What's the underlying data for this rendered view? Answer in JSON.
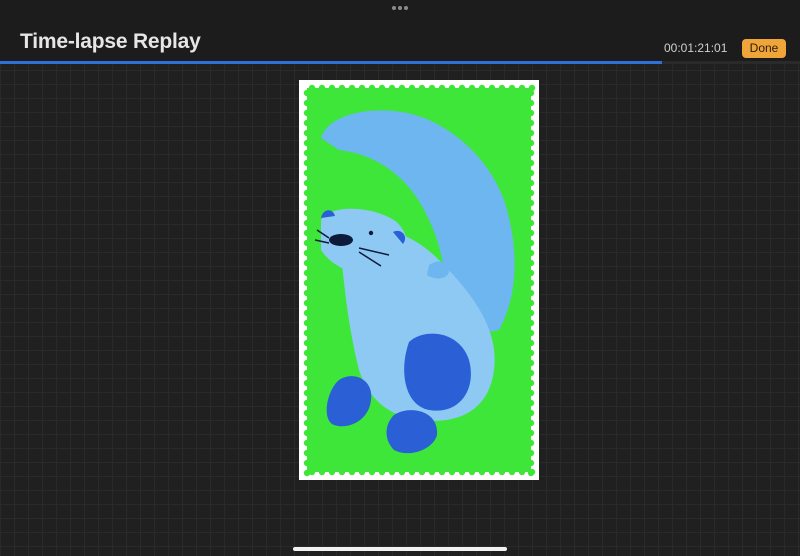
{
  "header": {
    "title": "Time-lapse Replay",
    "timecode": "00:01:21:01",
    "done_label": "Done"
  },
  "playback": {
    "progress": 0.827
  },
  "icons": {
    "grabber": "more-dots-icon"
  },
  "colors": {
    "accent": "#f0a53a",
    "progress": "#2e6fd8",
    "background": "#202020",
    "artwork_green": "#3fe63a",
    "artwork_otter_light": "#7fc3f5",
    "artwork_otter_dark": "#2a5fd6"
  }
}
